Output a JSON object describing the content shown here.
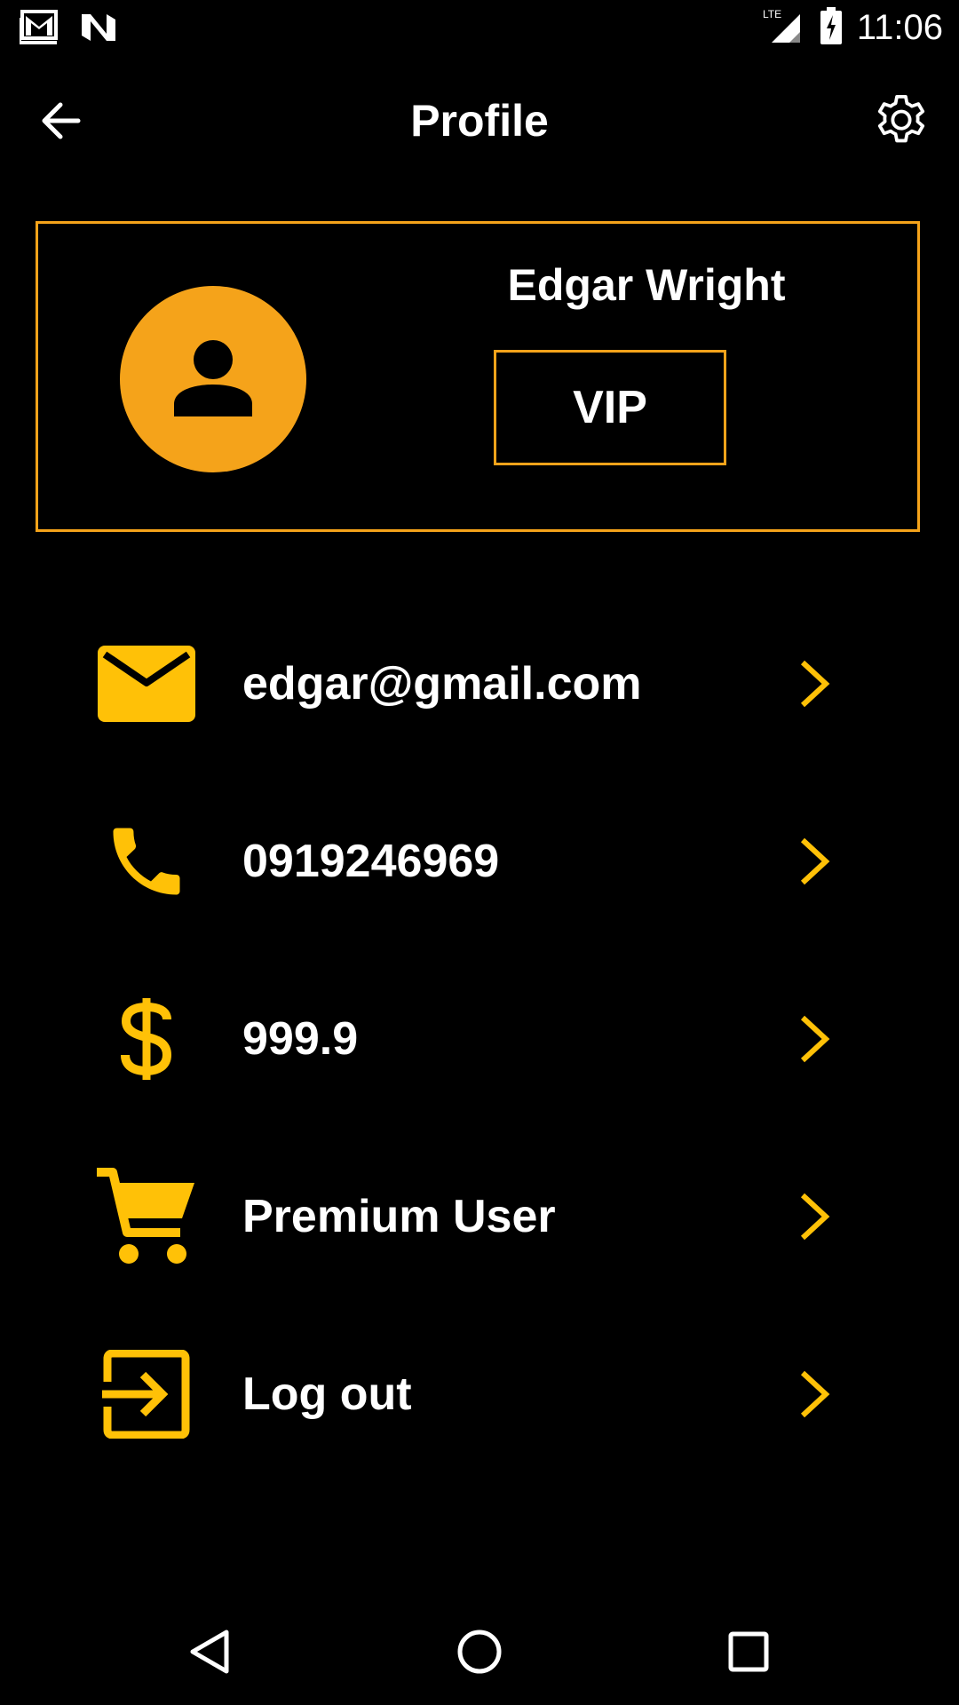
{
  "status_bar": {
    "time": "11:06",
    "network": "LTE",
    "left_icons": [
      "gmail-icon",
      "n-icon"
    ],
    "right_icons": [
      "signal-icon",
      "battery-charging-icon"
    ]
  },
  "header": {
    "title": "Profile",
    "back_icon": "arrow-back-icon",
    "settings_icon": "gear-icon"
  },
  "profile": {
    "name": "Edgar Wright",
    "badge": "VIP",
    "avatar_icon": "person-icon"
  },
  "menu": {
    "items": [
      {
        "icon": "email-icon",
        "label": "edgar@gmail.com"
      },
      {
        "icon": "phone-icon",
        "label": "0919246969"
      },
      {
        "icon": "dollar-icon",
        "label": "999.9"
      },
      {
        "icon": "cart-icon",
        "label": "Premium User"
      },
      {
        "icon": "logout-icon",
        "label": "Log out"
      }
    ]
  },
  "nav_bar": {
    "icons": [
      "back-triangle-icon",
      "home-circle-icon",
      "recents-square-icon"
    ]
  },
  "colors": {
    "accent": "#f5a31a",
    "icon_yellow": "#ffc107",
    "background": "#000000",
    "text": "#ffffff"
  }
}
